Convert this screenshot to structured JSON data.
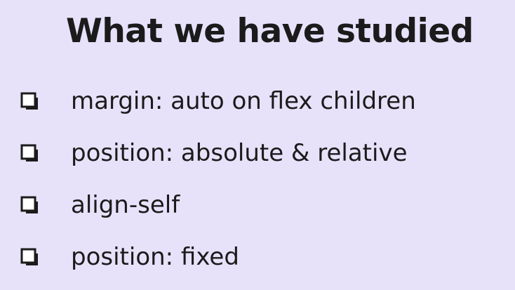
{
  "slide": {
    "title": "What we have studied",
    "items": [
      {
        "label": "margin: auto on flex children",
        "icon": "checkbox-icon"
      },
      {
        "label": "position: absolute & relative",
        "icon": "checkbox-icon"
      },
      {
        "label": "align-self",
        "icon": "checkbox-icon"
      },
      {
        "label": "position: fixed",
        "icon": "checkbox-icon"
      }
    ]
  },
  "colors": {
    "background": "#e7e2fa",
    "text": "#1b1b1b"
  }
}
